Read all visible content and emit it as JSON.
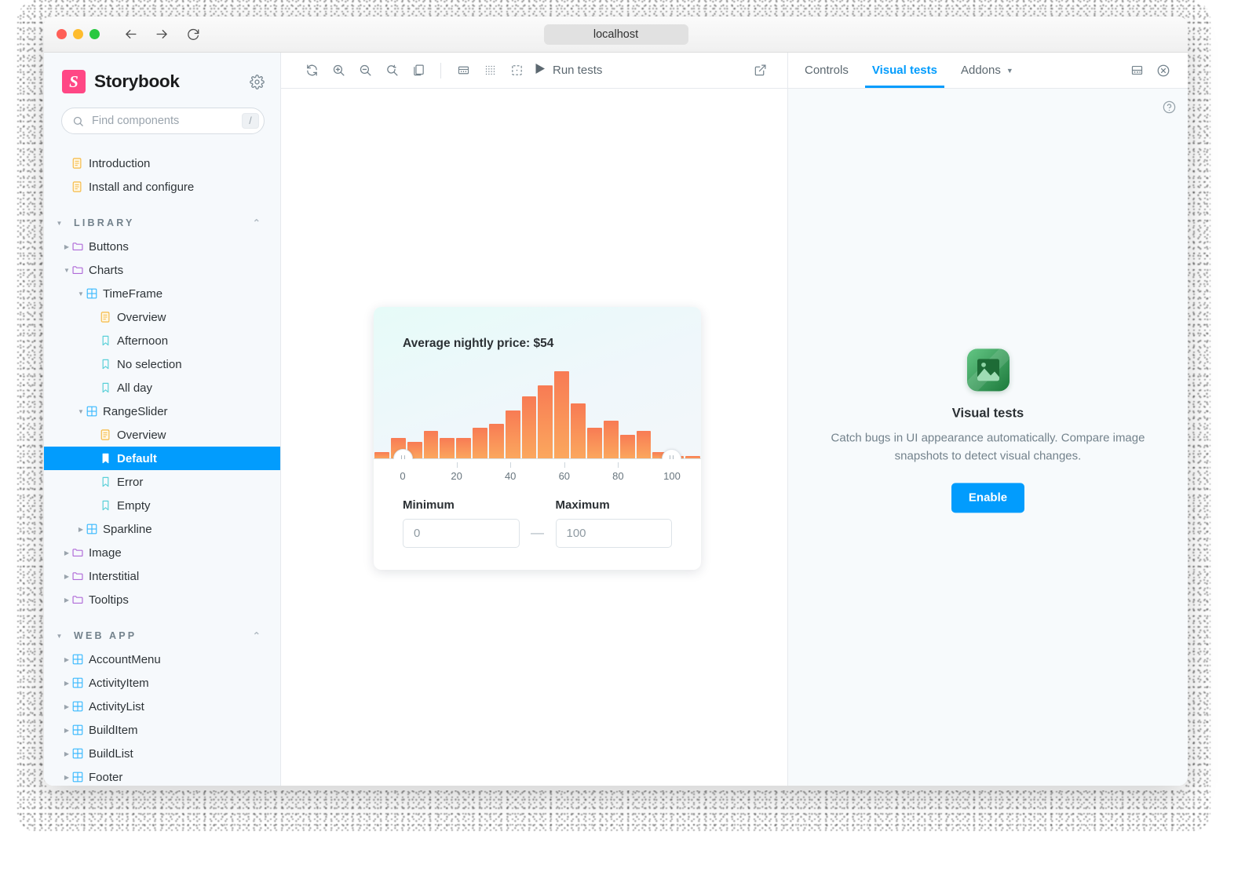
{
  "browser": {
    "url": "localhost",
    "back_icon": "arrow-left-icon",
    "forward_icon": "arrow-right-icon",
    "reload_icon": "reload-icon"
  },
  "sidebar": {
    "brand": "Storybook",
    "logo_letter": "S",
    "brand_color": "#ff4785",
    "settings_icon": "gear-icon",
    "search": {
      "placeholder": "Find components",
      "value": "",
      "shortcut": "/",
      "icon": "search-icon"
    },
    "docs": [
      {
        "label": "Introduction",
        "icon": "document-icon"
      },
      {
        "label": "Install and configure",
        "icon": "document-icon"
      }
    ],
    "sections": [
      {
        "title": "LIBRARY",
        "expanded": true,
        "items": [
          {
            "label": "Buttons",
            "icon": "folder-icon",
            "indent": 0,
            "expanded": false,
            "selected": false
          },
          {
            "label": "Charts",
            "icon": "folder-icon",
            "indent": 0,
            "expanded": true,
            "selected": false
          },
          {
            "label": "TimeFrame",
            "icon": "component-icon",
            "indent": 1,
            "expanded": true,
            "selected": false
          },
          {
            "label": "Overview",
            "icon": "document-icon",
            "indent": 2,
            "expanded": null,
            "selected": false
          },
          {
            "label": "Afternoon",
            "icon": "story-icon",
            "indent": 2,
            "expanded": null,
            "selected": false
          },
          {
            "label": "No selection",
            "icon": "story-icon",
            "indent": 2,
            "expanded": null,
            "selected": false
          },
          {
            "label": "All day",
            "icon": "story-icon",
            "indent": 2,
            "expanded": null,
            "selected": false
          },
          {
            "label": "RangeSlider",
            "icon": "component-icon",
            "indent": 1,
            "expanded": true,
            "selected": false
          },
          {
            "label": "Overview",
            "icon": "document-icon",
            "indent": 2,
            "expanded": null,
            "selected": false
          },
          {
            "label": "Default",
            "icon": "story-icon",
            "indent": 2,
            "expanded": null,
            "selected": true
          },
          {
            "label": "Error",
            "icon": "story-icon",
            "indent": 2,
            "expanded": null,
            "selected": false
          },
          {
            "label": "Empty",
            "icon": "story-icon",
            "indent": 2,
            "expanded": null,
            "selected": false
          },
          {
            "label": "Sparkline",
            "icon": "component-icon",
            "indent": 1,
            "expanded": false,
            "selected": false
          },
          {
            "label": "Image",
            "icon": "folder-icon",
            "indent": 0,
            "expanded": false,
            "selected": false
          },
          {
            "label": "Interstitial",
            "icon": "folder-icon",
            "indent": 0,
            "expanded": false,
            "selected": false
          },
          {
            "label": "Tooltips",
            "icon": "folder-icon",
            "indent": 0,
            "expanded": false,
            "selected": false
          }
        ]
      },
      {
        "title": "WEB APP",
        "expanded": true,
        "items": [
          {
            "label": "AccountMenu",
            "icon": "component-icon",
            "indent": 0,
            "expanded": false,
            "selected": false
          },
          {
            "label": "ActivityItem",
            "icon": "component-icon",
            "indent": 0,
            "expanded": false,
            "selected": false
          },
          {
            "label": "ActivityList",
            "icon": "component-icon",
            "indent": 0,
            "expanded": false,
            "selected": false
          },
          {
            "label": "BuildItem",
            "icon": "component-icon",
            "indent": 0,
            "expanded": false,
            "selected": false
          },
          {
            "label": "BuildList",
            "icon": "component-icon",
            "indent": 0,
            "expanded": false,
            "selected": false
          },
          {
            "label": "Footer",
            "icon": "component-icon",
            "indent": 0,
            "expanded": false,
            "selected": false
          }
        ]
      }
    ]
  },
  "toolbar": {
    "buttons": [
      {
        "name": "remount-icon",
        "title": "Remount component"
      },
      {
        "name": "zoom-in-icon",
        "title": "Zoom in"
      },
      {
        "name": "zoom-out-icon",
        "title": "Zoom out"
      },
      {
        "name": "zoom-reset-icon",
        "title": "Reset zoom"
      },
      {
        "name": "background-icon",
        "title": "Change background"
      },
      {
        "name": "measure-icon",
        "title": "Measure"
      },
      {
        "name": "grid-icon",
        "title": "Apply grid"
      },
      {
        "name": "outline-icon",
        "title": "Apply outlines"
      }
    ],
    "run_tests_label": "Run tests",
    "run_tests_icon": "play-icon",
    "open_new_tab_icon": "external-link-icon"
  },
  "story": {
    "title": "Average nightly price: $54",
    "minimum_label": "Minimum",
    "maximum_label": "Maximum",
    "minimum_value": "0",
    "maximum_value": "100",
    "separator": "—",
    "accent_from": "#f87b54",
    "accent_to": "#fba85e",
    "chart_data": {
      "type": "bar",
      "title": "Average nightly price: $54",
      "xlabel": "",
      "ylabel": "",
      "grid": false,
      "legend": null,
      "xlim": [
        0,
        100
      ],
      "ylim": [
        0,
        26
      ],
      "tick_labels": [
        "0",
        "20",
        "40",
        "60",
        "80",
        "100"
      ],
      "tick_values": [
        0,
        20,
        40,
        60,
        80,
        100
      ],
      "bin_width": 5,
      "categories": [
        "0-5",
        "5-10",
        "10-15",
        "15-20",
        "20-25",
        "25-30",
        "30-35",
        "35-40",
        "40-45",
        "45-50",
        "50-55",
        "55-60",
        "60-65",
        "65-70",
        "70-75",
        "75-80",
        "80-85",
        "85-90",
        "90-95",
        "95-100"
      ],
      "values": [
        2,
        6,
        5,
        8,
        6,
        6,
        9,
        10,
        14,
        18,
        21,
        25,
        16,
        9,
        11,
        7,
        8,
        2,
        1,
        1
      ],
      "slider": {
        "min_handle_value": 0,
        "max_handle_value": 100
      }
    }
  },
  "panel": {
    "tabs": [
      {
        "label": "Controls",
        "active": false,
        "dropdown": false
      },
      {
        "label": "Visual tests",
        "active": true,
        "dropdown": false
      },
      {
        "label": "Addons",
        "active": false,
        "dropdown": true
      }
    ],
    "layout_icon": "panel-position-icon",
    "close_icon": "close-icon",
    "help_icon": "help-circle-icon",
    "accent": "#029cfd",
    "empty_state": {
      "icon": "visual-tests-image-icon",
      "title": "Visual tests",
      "description": "Catch bugs in UI appearance automatically. Compare image snapshots to detect visual changes.",
      "button": "Enable"
    }
  }
}
